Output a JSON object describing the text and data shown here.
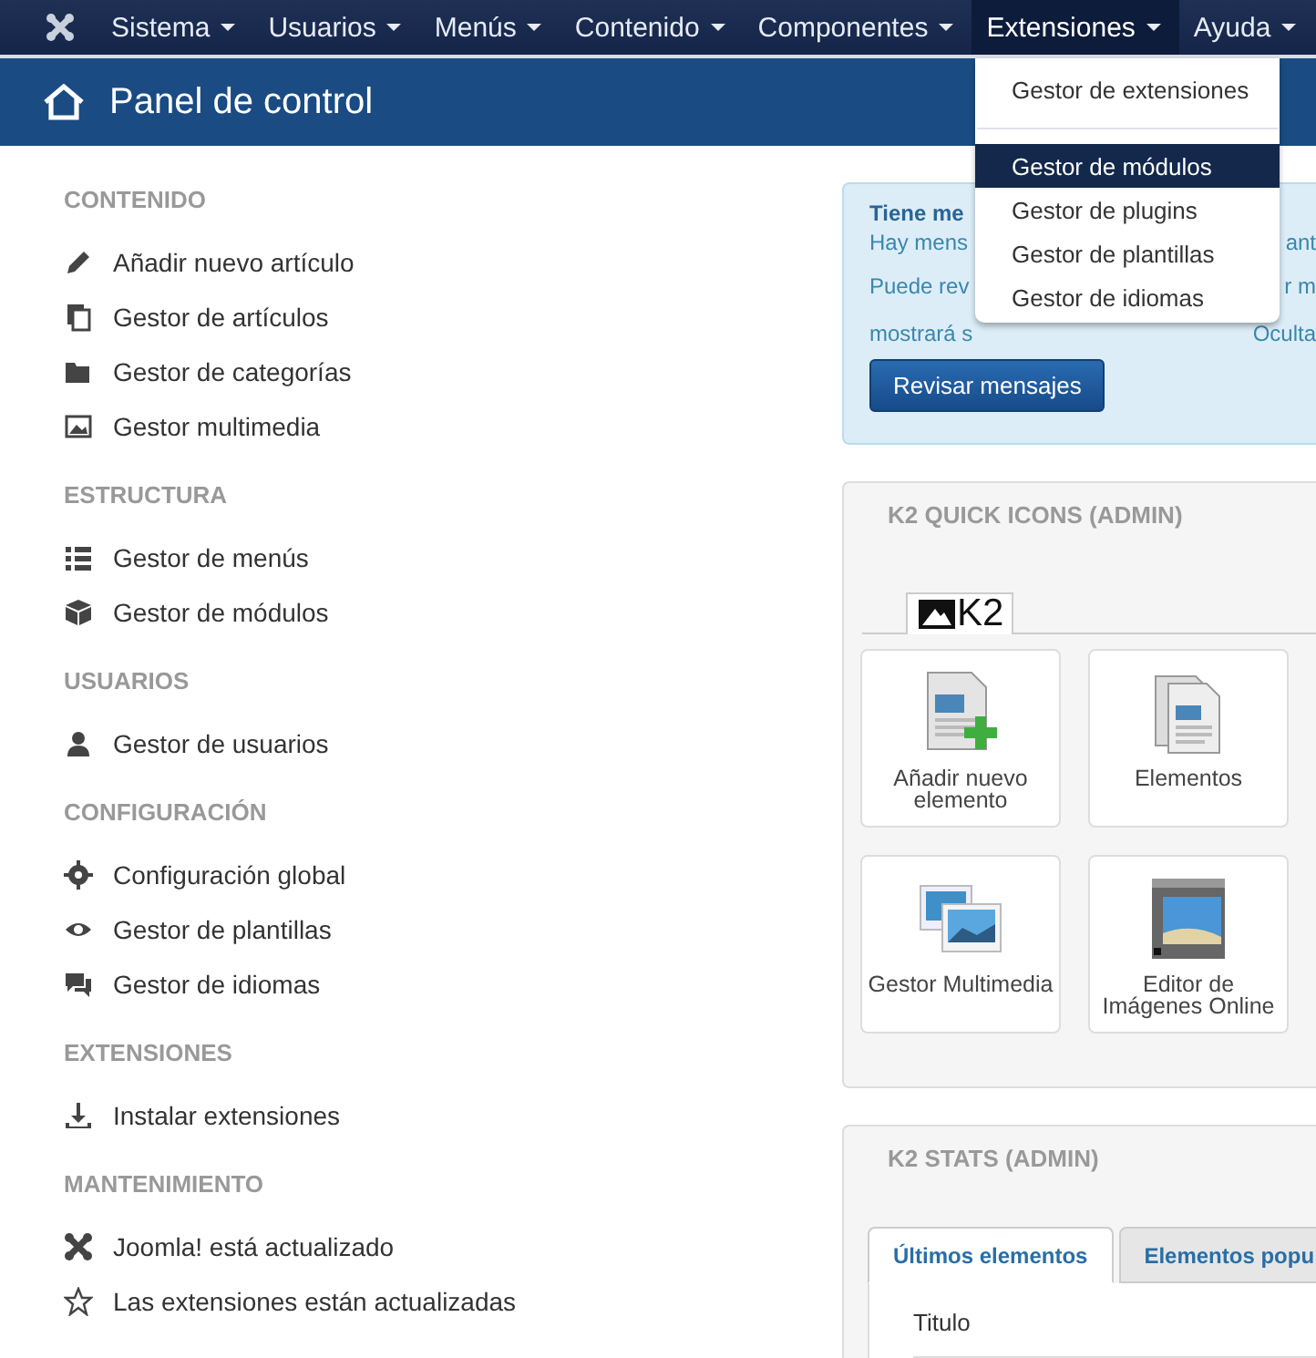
{
  "navbar": {
    "items": [
      {
        "label": "Sistema",
        "selected": false
      },
      {
        "label": "Usuarios",
        "selected": false
      },
      {
        "label": "Menús",
        "selected": false
      },
      {
        "label": "Contenido",
        "selected": false
      },
      {
        "label": "Componentes",
        "selected": false
      },
      {
        "label": "Extensiones",
        "selected": true
      },
      {
        "label": "Ayuda",
        "selected": false
      }
    ]
  },
  "dropdown": {
    "items": [
      {
        "label": "Gestor de extensiones",
        "selected": false,
        "divider_after": true
      },
      {
        "label": "Gestor de módulos",
        "selected": true,
        "divider_after": false
      },
      {
        "label": "Gestor de plugins",
        "selected": false,
        "divider_after": false
      },
      {
        "label": "Gestor de plantillas",
        "selected": false,
        "divider_after": false
      },
      {
        "label": "Gestor de idiomas",
        "selected": false,
        "divider_after": false
      }
    ]
  },
  "header": {
    "title": "Panel de control"
  },
  "sidebar": {
    "sections": [
      {
        "title": "CONTENIDO",
        "items": [
          "Añadir nuevo artículo",
          "Gestor de artículos",
          "Gestor de categorías",
          "Gestor multimedia"
        ]
      },
      {
        "title": "ESTRUCTURA",
        "items": [
          "Gestor de menús",
          "Gestor de módulos"
        ]
      },
      {
        "title": "USUARIOS",
        "items": [
          "Gestor de usuarios"
        ]
      },
      {
        "title": "CONFIGURACIÓN",
        "items": [
          "Configuración global",
          "Gestor de plantillas",
          "Gestor de idiomas"
        ]
      },
      {
        "title": "EXTENSIONES",
        "items": [
          "Instalar extensiones"
        ]
      },
      {
        "title": "MANTENIMIENTO",
        "items": [
          "Joomla! está actualizado",
          "Las extensiones están actualizadas"
        ]
      }
    ]
  },
  "message": {
    "title": "Tiene me",
    "lines": [
      {
        "left": "Hay mens",
        "right": "ant"
      },
      {
        "left": "Puede rev",
        "right": "r m"
      },
      {
        "left": "mostrará s",
        "right": "Oculta"
      }
    ],
    "button": "Revisar mensajes"
  },
  "quick_icons": {
    "title": "K2 QUICK ICONS (ADMIN)",
    "tab": "K2",
    "tiles": [
      "Añadir nuevo elemento",
      "Elementos",
      "Gestor Multimedia",
      "Editor de Imágenes Online"
    ]
  },
  "stats": {
    "title": "K2 STATS (ADMIN)",
    "tabs": [
      {
        "label": "Últimos elementos",
        "selected": true
      },
      {
        "label": "Elementos popu",
        "selected": false
      }
    ],
    "column": "Titulo"
  }
}
